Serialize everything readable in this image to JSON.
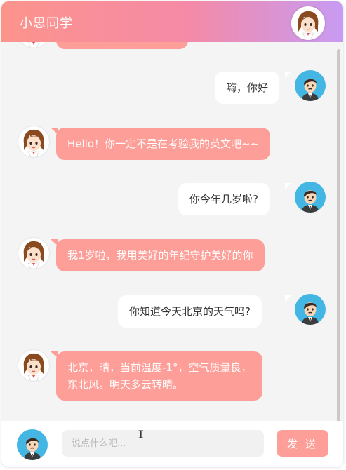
{
  "header": {
    "title": "小思同学"
  },
  "messages": [
    {
      "from": "user",
      "text": "嗨，你好"
    },
    {
      "from": "bot",
      "text": "Hello！你一定不是在考验我的英文吧~~"
    },
    {
      "from": "user",
      "text": "你今年几岁啦?"
    },
    {
      "from": "bot",
      "text": "我1岁啦，我用美好的年纪守护美好的你"
    },
    {
      "from": "user",
      "text": "你知道今天北京的天气吗?"
    },
    {
      "from": "bot",
      "lines": [
        "北京，晴，当前温度-1°，空气质量良，",
        "东北风。明天多云转晴。"
      ]
    }
  ],
  "input": {
    "placeholder": "说点什么吧..."
  },
  "send_button": {
    "label": "发 送"
  },
  "colors": {
    "accent": "#fd9f98",
    "header_start": "#fd948c",
    "header_end": "#c79bf3",
    "user_avatar_bg": "#44b6e4"
  }
}
